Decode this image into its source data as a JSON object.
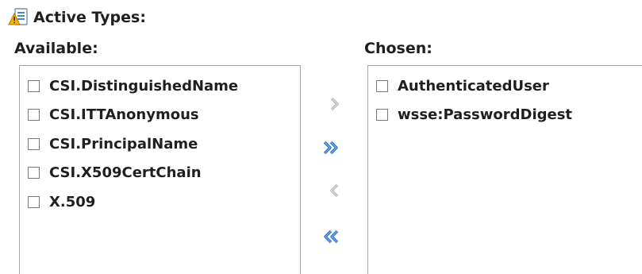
{
  "header": {
    "title": "Active Types:",
    "icon": "warning-list-icon"
  },
  "available": {
    "label": "Available:",
    "items": [
      {
        "label": "CSI.DistinguishedName",
        "checked": false
      },
      {
        "label": "CSI.ITTAnonymous",
        "checked": false
      },
      {
        "label": "CSI.PrincipalName",
        "checked": false
      },
      {
        "label": "CSI.X509CertChain",
        "checked": false
      },
      {
        "label": "X.509",
        "checked": false
      }
    ]
  },
  "chosen": {
    "label": "Chosen:",
    "items": [
      {
        "label": "AuthenticatedUser",
        "checked": false
      },
      {
        "label": "wsse:PasswordDigest",
        "checked": false
      }
    ]
  },
  "shuttle": {
    "move_selected": {
      "icon": "chevron-right-icon",
      "enabled": false
    },
    "move_all": {
      "icon": "double-chevron-right-icon",
      "enabled": true
    },
    "remove_selected": {
      "icon": "chevron-left-icon",
      "enabled": false
    },
    "remove_all": {
      "icon": "double-chevron-left-icon",
      "enabled": true
    }
  },
  "colors": {
    "enabled_arrow": "#2a6fcf",
    "disabled_arrow": "#a9a9a9",
    "warning": "#e6a817"
  }
}
